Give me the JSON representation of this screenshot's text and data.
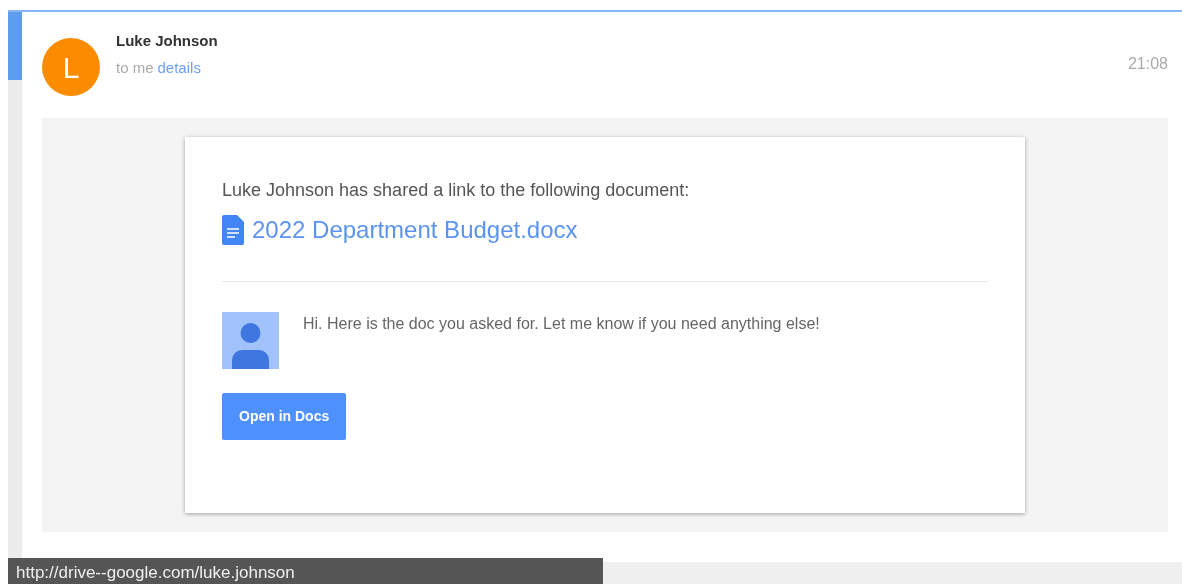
{
  "message": {
    "sender": "Luke Johnson",
    "avatar_letter": "L",
    "recipient": "to me",
    "details_link": "details",
    "time": "21:08"
  },
  "share_card": {
    "intro": "Luke Johnson has shared a link to the following document:",
    "document": "2022 Department Budget.docx",
    "note": "Hi. Here is the doc you asked for. Let me know if you need anything else!",
    "button": "Open in Docs"
  },
  "status_bar": {
    "url": "http://drive--google.com/luke.johnson"
  }
}
